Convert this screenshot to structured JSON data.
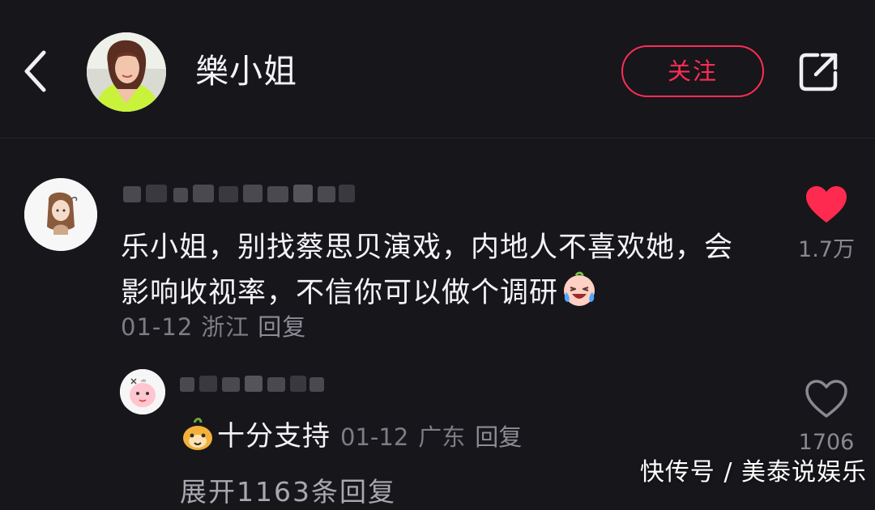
{
  "header": {
    "username": "樂小姐",
    "follow_label": "关注",
    "back_icon": "chevron-left-icon",
    "share_icon": "share-external-icon"
  },
  "comment": {
    "author_name_hidden": true,
    "text": "乐小姐，别找蔡思贝演戏，内地人不喜欢她，会影响收视率，不信你可以做个调研",
    "emoji": "laugh-cry-emoji",
    "date": "01-12",
    "location": "浙江",
    "reply_label": "回复",
    "like_count": "1.7万",
    "liked": true
  },
  "reply": {
    "author_name_hidden": true,
    "sticker": "sticker-emoji",
    "text": "十分支持",
    "date": "01-12",
    "location": "广东",
    "reply_label": "回复",
    "like_count": "1706",
    "liked": false
  },
  "expand_label": "展开1163条回复",
  "watermark": "快传号 / 美泰说娱乐",
  "colors": {
    "background": "#17161b",
    "accent": "#ff2d55",
    "muted": "#7e7c85",
    "text": "#f4f4f6"
  }
}
